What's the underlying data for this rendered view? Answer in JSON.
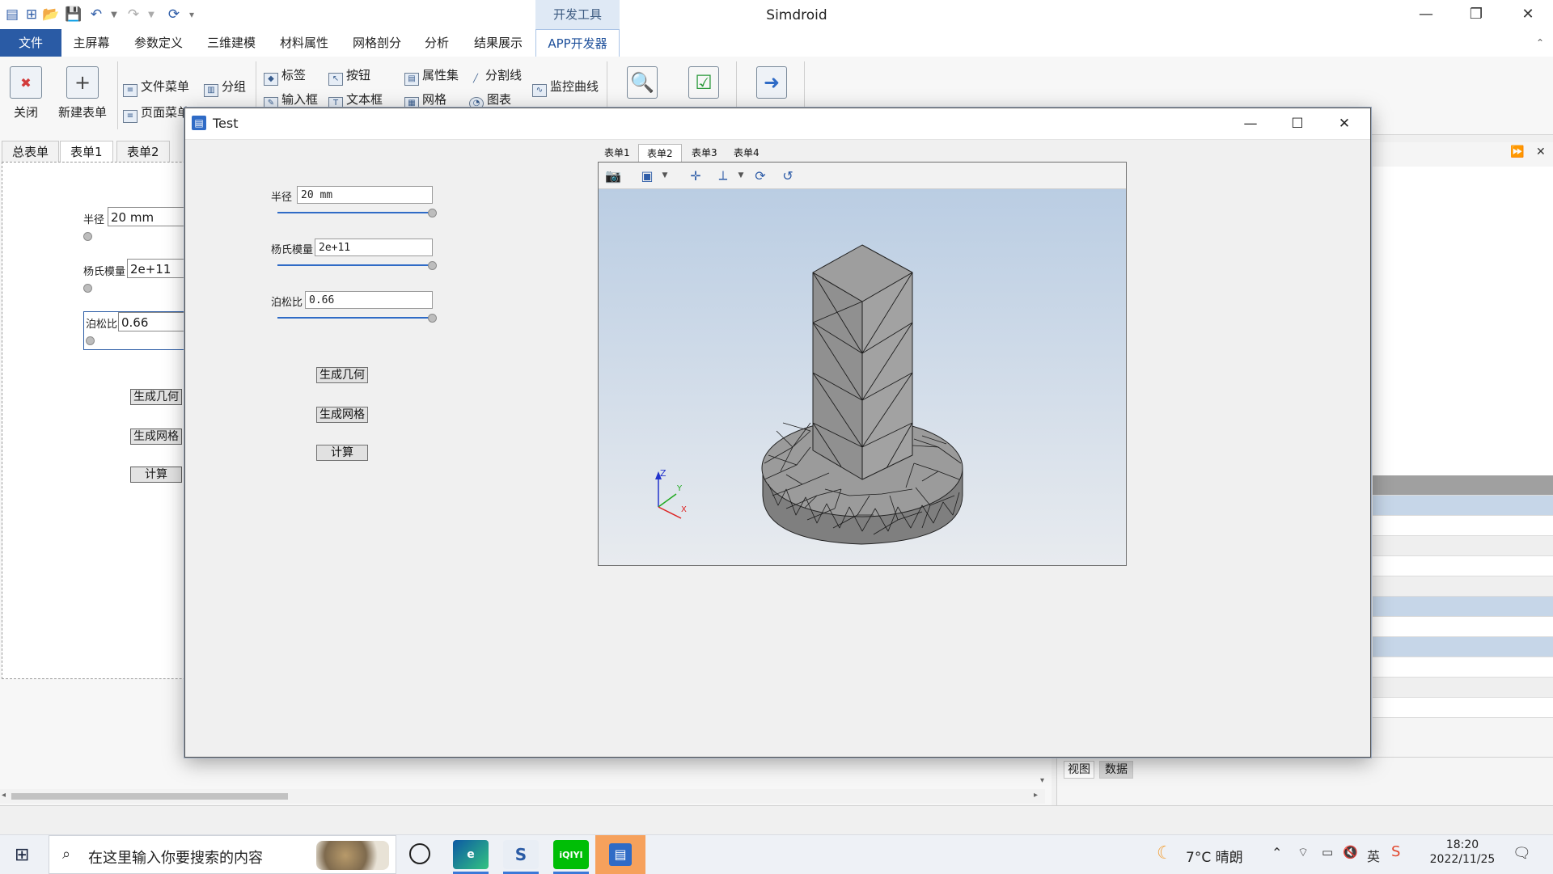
{
  "app": {
    "title": "Simdroid",
    "dev_tools_tab": "开发工具"
  },
  "ribbon_tabs": [
    "文件",
    "主屏幕",
    "参数定义",
    "三维建模",
    "材料属性",
    "网格剖分",
    "分析",
    "结果展示",
    "APP开发器"
  ],
  "ribbon": {
    "close": "关闭",
    "new_form": "新建表单",
    "file_menu": "文件菜单",
    "page_menu": "页面菜单",
    "group": "分组",
    "label": "标签",
    "button": "按钮",
    "input_box": "输入框",
    "text_box": "文本框",
    "property_set": "属性集",
    "splitter": "分割线",
    "mesh": "网格",
    "chart": "图表",
    "monitor_curve": "监控曲线"
  },
  "doc_tabs": [
    "总表单",
    "表单1",
    "表单2"
  ],
  "canvas_form": {
    "radius_label": "半径",
    "radius_value": "20 mm",
    "young_label": "杨氏模量",
    "young_value": "2e+11",
    "poisson_label": "泊松比",
    "poisson_value": "0.66",
    "gen_geometry": "生成几何",
    "gen_mesh": "生成网格",
    "compute": "计算"
  },
  "dialog": {
    "title": "Test",
    "radius_label": "半径",
    "radius_value": "20 mm",
    "young_label": "杨氏模量",
    "young_value": "2e+11",
    "poisson_label": "泊松比",
    "poisson_value": "0.66",
    "gen_geometry": "生成几何",
    "gen_mesh": "生成网格",
    "compute": "计算",
    "sliders": {
      "radius": 1.0,
      "young": 1.0,
      "poisson": 1.0
    },
    "viewer_tabs": [
      "表单1",
      "表单2",
      "表单3",
      "表单4"
    ],
    "viewer_active_tab": 1,
    "axis_labels": {
      "x": "X",
      "y": "Y",
      "z": "Z"
    }
  },
  "right_panel": {
    "bottom_tabs": [
      "视图",
      "数据"
    ]
  },
  "taskbar": {
    "search_placeholder": "在这里输入你要搜索的内容",
    "weather": "7°C  晴朗",
    "ime": "英",
    "time": "18:20",
    "date": "2022/11/25",
    "iqiyi": "iQIYI"
  },
  "colors": {
    "file_tab": "#2a5ba5",
    "accent": "#2f6bc6",
    "viewer_top": "#b7cbe2",
    "viewer_bottom": "#e8ebef",
    "model_fill": "#9a9a9a"
  }
}
